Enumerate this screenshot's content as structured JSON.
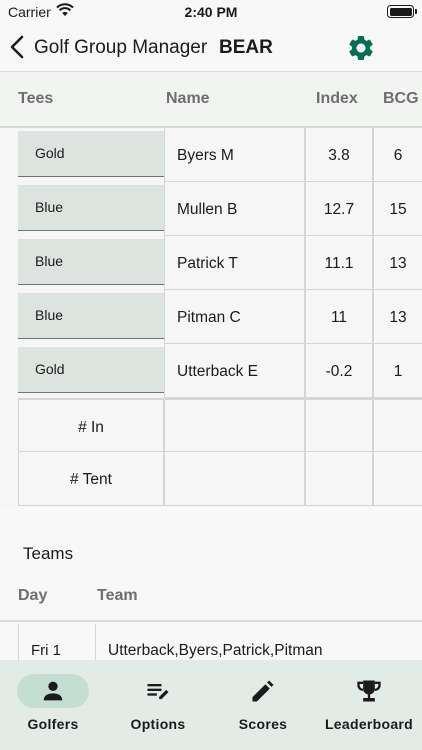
{
  "status_bar": {
    "carrier": "Carrier",
    "time": "2:40 PM"
  },
  "nav": {
    "title": "Golf Group Manager",
    "group": "BEAR"
  },
  "colors": {
    "accent": "#0a6b56",
    "tab_bar": "#e3ebe6",
    "tee_button": "#dde3df",
    "active_pill": "#c5ded3"
  },
  "golfers_table": {
    "headers": {
      "tees": "Tees",
      "name": "Name",
      "index": "Index",
      "bcg": "BCG"
    },
    "rows": [
      {
        "tee": "Gold",
        "name": "Byers M",
        "index": "3.8",
        "bcg": "6"
      },
      {
        "tee": "Blue",
        "name": "Mullen B",
        "index": "12.7",
        "bcg": "15"
      },
      {
        "tee": "Blue",
        "name": "Patrick T",
        "index": "11.1",
        "bcg": "13"
      },
      {
        "tee": "Blue",
        "name": "Pitman C",
        "index": "11",
        "bcg": "13"
      },
      {
        "tee": "Gold",
        "name": "Utterback E",
        "index": "-0.2",
        "bcg": "1"
      }
    ],
    "summary": {
      "in_label": "# In",
      "tent_label": "# Tent"
    }
  },
  "teams": {
    "title": "Teams",
    "headers": {
      "day": "Day",
      "team": "Team"
    },
    "rows": [
      {
        "day": "Fri 1",
        "team": "Utterback,Byers,Patrick,Pitman"
      }
    ]
  },
  "tab_bar": {
    "tabs": [
      {
        "label": "Golfers",
        "icon": "person-icon",
        "active": true
      },
      {
        "label": "Options",
        "icon": "edit-list-icon",
        "active": false
      },
      {
        "label": "Scores",
        "icon": "pencil-icon",
        "active": false
      },
      {
        "label": "Leaderboard",
        "icon": "trophy-icon",
        "active": false
      }
    ]
  }
}
